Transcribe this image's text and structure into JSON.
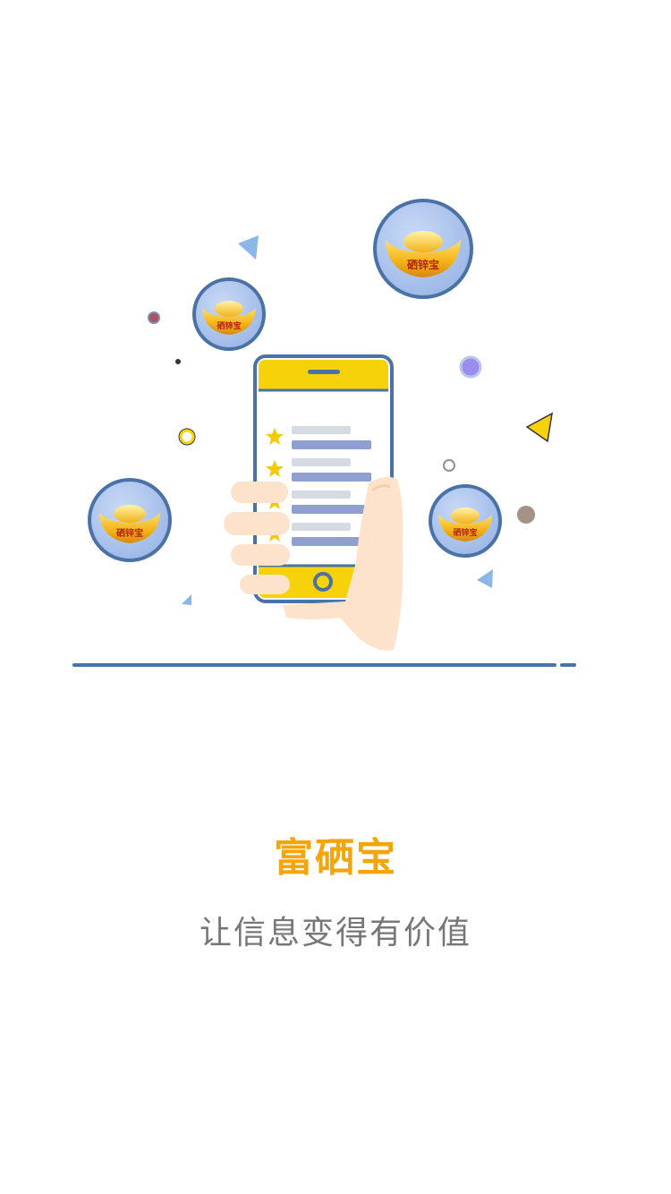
{
  "splash": {
    "title": "富硒宝",
    "slogan": "让信息变得有价值"
  },
  "illustration": {
    "coin_label": "硒锌宝"
  },
  "colors": {
    "title": "#f5a40a",
    "slogan": "#777777",
    "phone_frame": "#4a72a6",
    "phone_accent": "#f5d20a",
    "bubble_fill": "#a8c2ec",
    "gold": "#f3b21a"
  },
  "icons": [
    "star-icon",
    "gold-ingot-icon",
    "triangle-icon",
    "dot-icon"
  ]
}
